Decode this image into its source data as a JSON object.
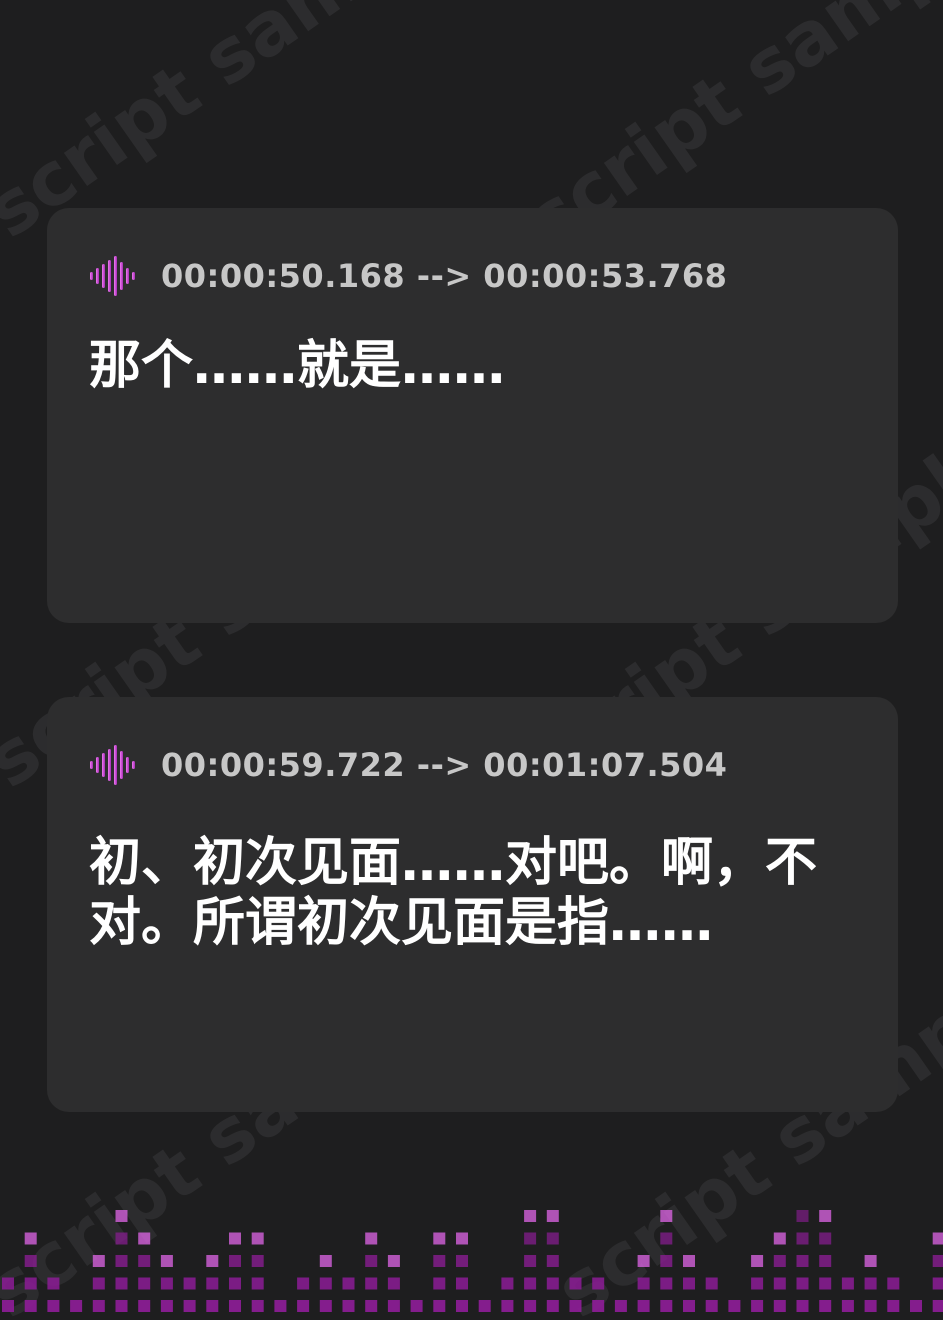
{
  "watermark": {
    "text": "script sample"
  },
  "cards": [
    {
      "timestamp": "00:00:50.168 --> 00:00:53.768",
      "text": "那个……就是……"
    },
    {
      "timestamp": "00:00:59.722 --> 00:01:07.504",
      "text": "初、初次见面……对吧。啊，不对。所谓初次见面是指……"
    }
  ],
  "icons": {
    "header_icon": "audio-waveform-icon"
  },
  "colors": {
    "background": "#1e1e1f",
    "card": "#2d2d2e",
    "accent_light": "#e066e8",
    "accent_dark": "#8a1d93",
    "timestamp": "#c7c7c7",
    "text": "#ffffff"
  },
  "equalizer": {
    "levels": [
      2,
      4,
      2,
      1,
      3,
      5,
      4,
      3,
      2,
      3,
      4,
      4,
      1,
      2,
      3,
      2,
      4,
      3,
      1,
      4,
      4,
      1,
      2,
      5,
      5,
      2,
      2,
      1,
      3,
      5,
      3,
      2,
      1,
      3,
      4,
      6,
      5,
      2,
      3,
      2,
      1,
      4,
      2,
      2,
      1
    ]
  }
}
